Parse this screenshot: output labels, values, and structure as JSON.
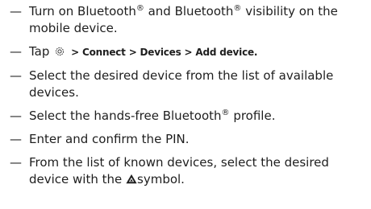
{
  "steps": [
    {
      "bullet": "—",
      "parts": [
        "Turn on Bluetooth",
        "®",
        " and Bluetooth",
        "®",
        " visibility on the mobile device."
      ]
    },
    {
      "bullet": "—",
      "prefix": "Tap ",
      "icon": "gear-icon",
      "separator": " > ",
      "menu": [
        "Connect",
        "Devices",
        "Add device."
      ]
    },
    {
      "bullet": "—",
      "text": "Select the desired device from the list of available devices."
    },
    {
      "bullet": "—",
      "parts": [
        "Select the hands-free Bluetooth",
        "®",
        " profile."
      ]
    },
    {
      "bullet": "—",
      "text": "Enter and confirm the PIN."
    },
    {
      "bullet": "—",
      "prefix": "From the list of known devices, select the desired device with the ",
      "icon": "warning-triangle-icon",
      "suffix": "symbol."
    }
  ]
}
